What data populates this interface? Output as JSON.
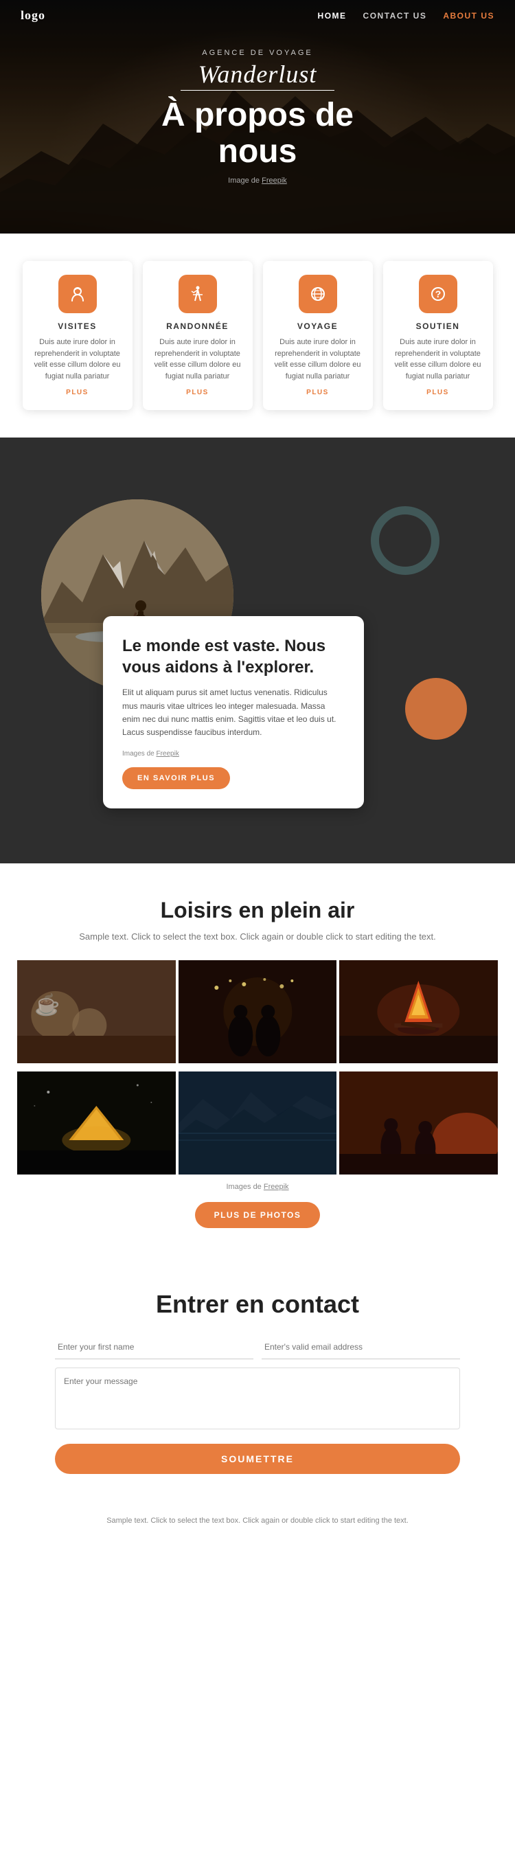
{
  "nav": {
    "logo": "logo",
    "links": [
      {
        "label": "HOME",
        "key": "home",
        "active": false
      },
      {
        "label": "CONTACT US",
        "key": "contact",
        "active": false
      },
      {
        "label": "ABOUT US",
        "key": "about",
        "active": true
      }
    ]
  },
  "hero": {
    "agency_label": "AGENCE DE VOYAGE",
    "brand": "Wanderlust",
    "title_line1": "À propos de",
    "title_line2": "nous",
    "credit_text": "Image de",
    "credit_link": "Freepik"
  },
  "cards": [
    {
      "icon": "♻",
      "title": "VISITES",
      "text": "Duis aute irure dolor in reprehenderit in voluptate velit esse cillum dolore eu fugiat nulla pariatur",
      "link": "PLUS"
    },
    {
      "icon": "🏔",
      "title": "RANDONNÉE",
      "text": "Duis aute irure dolor in reprehenderit in voluptate velit esse cillum dolore eu fugiat nulla pariatur",
      "link": "PLUS"
    },
    {
      "icon": "✦",
      "title": "VOYAGE",
      "text": "Duis aute irure dolor in reprehenderit in voluptate velit esse cillum dolore eu fugiat nulla pariatur",
      "link": "PLUS"
    },
    {
      "icon": "?",
      "title": "SOUTIEN",
      "text": "Duis aute irure dolor in reprehenderit in voluptate velit esse cillum dolore eu fugiat nulla pariatur",
      "link": "PLUS"
    }
  ],
  "dark_section": {
    "title": "Le monde est vaste. Nous vous aidons à l'explorer.",
    "body": "Elit ut aliquam purus sit amet luctus venenatis. Ridiculus mus mauris vitae ultrices leo integer malesuada. Massa enim nec dui nunc mattis enim. Sagittis vitae et leo duis ut. Lacus suspendisse faucibus interdum.",
    "credit_text": "Images de",
    "credit_link": "Freepik",
    "button_label": "EN SAVOIR PLUS"
  },
  "leisure": {
    "title": "Loisirs en plein air",
    "subtitle": "Sample text. Click to select the text box. Click again or double click to start\nediting the text.",
    "credit_text": "Images de",
    "credit_link": "Freepik",
    "button_label": "PLUS DE PHOTOS"
  },
  "contact": {
    "title": "Entrer en contact",
    "first_name_placeholder": "Enter your first name",
    "email_placeholder": "Enter's valid email address",
    "message_placeholder": "Enter your message",
    "button_label": "SOUMETTRE"
  },
  "footer": {
    "text": "Sample text. Click to select the text box. Click again or double\nclick to start editing the text."
  }
}
